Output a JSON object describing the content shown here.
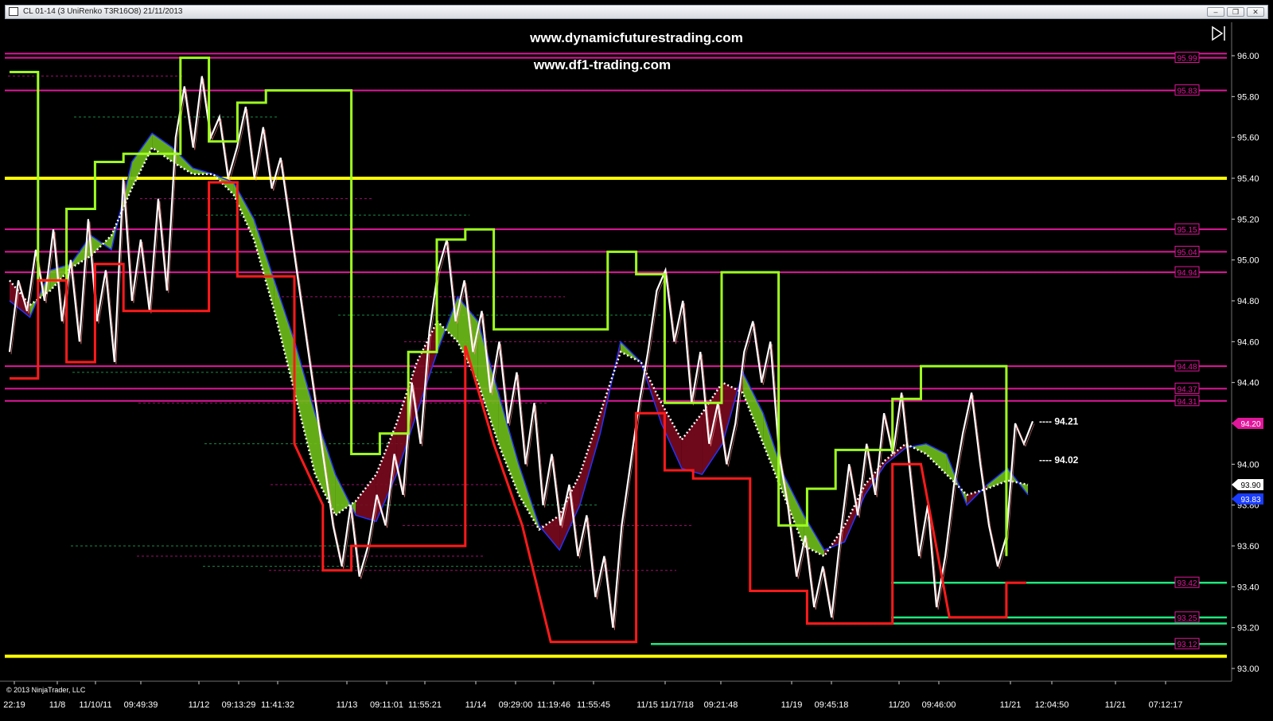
{
  "window": {
    "title": "CL 01-14 (3 UniRenko T3R16O8)  21/11/2013",
    "buttons": {
      "minimize": "–",
      "maximize": "❐",
      "close": "✕"
    }
  },
  "watermark": {
    "line1": "www.dynamicfuturestrading.com",
    "line2": "www.df1-trading.com"
  },
  "copyright": "© 2013 NinjaTrader, LLC",
  "colors": {
    "background": "#000000",
    "level_magenta": "#e0179a",
    "level_yellow": "#ffff00",
    "level_green": "#1fe87e",
    "channel_upper": "#9eff1f",
    "channel_lower": "#ff1a1a",
    "ribbon_bull": "#6fbf1a",
    "ribbon_bear": "#7a0a1e"
  },
  "chart_data": {
    "type": "line",
    "title": "",
    "ylim": [
      93.0,
      96.0
    ],
    "y_ticks": [
      "96.00",
      "95.80",
      "95.60",
      "95.40",
      "95.20",
      "95.00",
      "94.80",
      "94.60",
      "94.40",
      "94.20",
      "94.00",
      "93.80",
      "93.60",
      "93.40",
      "93.20",
      "93.00"
    ],
    "x_labels": [
      "22:19",
      "11/8",
      "11/10/11",
      "09:49:39",
      "11/12",
      "09:13:29",
      "11:41:32",
      "11/13",
      "09:11:01",
      "11:55:21",
      "11/14",
      "09:29:00",
      "11:19:46",
      "11:55:45",
      "11/15 11/17/18",
      "09:21:48",
      "11/19",
      "09:45:18",
      "11/20",
      "09:46:00",
      "11/21",
      "12:04:50",
      "11/21",
      "07:12:17"
    ],
    "level_labels": [
      {
        "value": 95.99,
        "label": "95.99",
        "color": "#e0179a"
      },
      {
        "value": 95.83,
        "label": "95.83",
        "color": "#e0179a"
      },
      {
        "value": 95.15,
        "label": "95.15",
        "color": "#e0179a"
      },
      {
        "value": 95.04,
        "label": "95.04",
        "color": "#e0179a"
      },
      {
        "value": 94.94,
        "label": "94.94",
        "color": "#e0179a"
      },
      {
        "value": 94.48,
        "label": "94.48",
        "color": "#e0179a"
      },
      {
        "value": 94.37,
        "label": "94.37",
        "color": "#e0179a"
      },
      {
        "value": 94.31,
        "label": "94.31",
        "color": "#e0179a"
      },
      {
        "value": 93.42,
        "label": "93.42",
        "color": "#e0179a"
      },
      {
        "value": 93.25,
        "label": "93.25",
        "color": "#e0179a"
      },
      {
        "value": 93.12,
        "label": "93.12",
        "color": "#e0179a"
      }
    ],
    "price_markers": [
      {
        "value": 94.2,
        "label": "94.20",
        "style": "magenta"
      },
      {
        "value": 93.9,
        "label": "93.90",
        "style": "white"
      },
      {
        "value": 93.83,
        "label": "93.83",
        "style": "blue"
      }
    ],
    "annotations": [
      {
        "value": 94.21,
        "label": "---- 94.21"
      },
      {
        "value": 94.02,
        "label": "---- 94.02"
      }
    ],
    "horizontal_levels": [
      {
        "value": 96.01,
        "color": "magenta"
      },
      {
        "value": 95.99,
        "color": "magenta"
      },
      {
        "value": 95.83,
        "color": "magenta"
      },
      {
        "value": 95.4,
        "color": "yellow"
      },
      {
        "value": 95.15,
        "color": "magenta"
      },
      {
        "value": 95.04,
        "color": "magenta"
      },
      {
        "value": 94.94,
        "color": "magenta"
      },
      {
        "value": 94.48,
        "color": "magenta"
      },
      {
        "value": 94.37,
        "color": "magenta"
      },
      {
        "value": 94.31,
        "color": "magenta"
      },
      {
        "value": 93.42,
        "color": "green"
      },
      {
        "value": 93.25,
        "color": "green"
      },
      {
        "value": 93.22,
        "color": "green"
      },
      {
        "value": 93.12,
        "color": "green"
      },
      {
        "value": 93.06,
        "color": "yellow"
      }
    ],
    "price_path": [
      94.55,
      94.9,
      94.75,
      95.05,
      94.8,
      95.15,
      94.7,
      95.0,
      94.6,
      95.2,
      94.7,
      94.95,
      94.5,
      95.4,
      94.8,
      95.1,
      94.75,
      95.3,
      94.85,
      95.6,
      95.85,
      95.55,
      95.9,
      95.6,
      95.7,
      95.4,
      95.55,
      95.75,
      95.4,
      95.65,
      95.35,
      95.5,
      95.2,
      94.9,
      94.6,
      94.3,
      94.0,
      93.7,
      93.5,
      93.8,
      93.45,
      93.6,
      93.85,
      93.7,
      94.05,
      93.85,
      94.4,
      94.1,
      94.65,
      94.95,
      95.1,
      94.7,
      94.9,
      94.55,
      94.75,
      94.35,
      94.6,
      94.2,
      94.45,
      94.0,
      94.3,
      93.8,
      94.05,
      93.7,
      93.9,
      93.55,
      93.75,
      93.35,
      93.55,
      93.2,
      93.7,
      94.0,
      94.3,
      94.55,
      94.85,
      94.95,
      94.6,
      94.8,
      94.3,
      94.55,
      94.1,
      94.3,
      94.0,
      94.2,
      94.55,
      94.7,
      94.4,
      94.6,
      94.05,
      93.8,
      93.45,
      93.65,
      93.3,
      93.5,
      93.25,
      93.65,
      94.0,
      93.75,
      94.1,
      93.85,
      94.25,
      94.05,
      94.35,
      93.95,
      93.55,
      93.8,
      93.3,
      93.55,
      93.9,
      94.15,
      94.35,
      94.0,
      93.7,
      93.5,
      93.65,
      94.2,
      94.1,
      94.21
    ],
    "upper_channel": [
      [
        0,
        95.92
      ],
      [
        1,
        95.92
      ],
      [
        1,
        94.9
      ],
      [
        2,
        94.9
      ],
      [
        2,
        95.25
      ],
      [
        3,
        95.25
      ],
      [
        3,
        95.48
      ],
      [
        4,
        95.48
      ],
      [
        4,
        95.52
      ],
      [
        6,
        95.52
      ],
      [
        6,
        95.99
      ],
      [
        7,
        95.99
      ],
      [
        7,
        95.58
      ],
      [
        8,
        95.58
      ],
      [
        8,
        95.77
      ],
      [
        9,
        95.77
      ],
      [
        9,
        95.83
      ],
      [
        12,
        95.83
      ],
      [
        12,
        94.05
      ],
      [
        13,
        94.05
      ],
      [
        13,
        94.15
      ],
      [
        14,
        94.15
      ],
      [
        14,
        94.55
      ],
      [
        15,
        94.55
      ],
      [
        15,
        95.1
      ],
      [
        16,
        95.1
      ],
      [
        16,
        95.15
      ],
      [
        17,
        95.15
      ],
      [
        17,
        94.66
      ],
      [
        21,
        94.66
      ],
      [
        21,
        95.04
      ],
      [
        22,
        95.04
      ],
      [
        22,
        94.93
      ],
      [
        23,
        94.93
      ],
      [
        23,
        94.3
      ],
      [
        25,
        94.3
      ],
      [
        25,
        94.94
      ],
      [
        27,
        94.94
      ],
      [
        27,
        93.7
      ],
      [
        28,
        93.7
      ],
      [
        28,
        93.88
      ],
      [
        29,
        93.88
      ],
      [
        29,
        94.07
      ],
      [
        31,
        94.07
      ],
      [
        31,
        94.32
      ],
      [
        32,
        94.32
      ],
      [
        32,
        94.48
      ],
      [
        35,
        94.48
      ],
      [
        35,
        93.55
      ]
    ],
    "lower_channel": [
      [
        0,
        94.42
      ],
      [
        1,
        94.42
      ],
      [
        1,
        94.9
      ],
      [
        2,
        94.9
      ],
      [
        2,
        94.5
      ],
      [
        3,
        94.5
      ],
      [
        3,
        94.98
      ],
      [
        4,
        94.98
      ],
      [
        4,
        94.75
      ],
      [
        7,
        94.75
      ],
      [
        7,
        95.38
      ],
      [
        8,
        95.38
      ],
      [
        8,
        94.92
      ],
      [
        10,
        94.92
      ],
      [
        10,
        94.1
      ],
      [
        11,
        93.8
      ],
      [
        11,
        93.48
      ],
      [
        12,
        93.48
      ],
      [
        12,
        93.6
      ],
      [
        16,
        93.6
      ],
      [
        16,
        94.58
      ],
      [
        17,
        94.1
      ],
      [
        18,
        93.7
      ],
      [
        19,
        93.13
      ],
      [
        22,
        93.13
      ],
      [
        22,
        94.25
      ],
      [
        23,
        94.25
      ],
      [
        23,
        93.97
      ],
      [
        24,
        93.97
      ],
      [
        24,
        93.93
      ],
      [
        26,
        93.93
      ],
      [
        26,
        93.38
      ],
      [
        28,
        93.38
      ],
      [
        28,
        93.22
      ],
      [
        31,
        93.22
      ],
      [
        31,
        94.0
      ],
      [
        32,
        94.0
      ],
      [
        33,
        93.25
      ],
      [
        35,
        93.25
      ],
      [
        35,
        93.42
      ],
      [
        35.7,
        93.42
      ]
    ],
    "ribbon_fast": [
      94.8,
      94.72,
      94.95,
      94.98,
      95.12,
      95.05,
      95.48,
      95.62,
      95.55,
      95.45,
      95.42,
      95.38,
      95.2,
      94.9,
      94.6,
      94.25,
      93.95,
      93.75,
      93.72,
      93.95,
      94.25,
      94.55,
      94.82,
      94.7,
      94.35,
      94.0,
      93.7,
      93.58,
      93.8,
      94.15,
      94.6,
      94.5,
      94.2,
      93.98,
      93.95,
      94.1,
      94.45,
      94.25,
      93.95,
      93.75,
      93.58,
      93.62,
      93.85,
      94.0,
      94.08,
      94.1,
      94.05,
      93.8,
      93.9,
      93.98,
      93.85
    ],
    "ribbon_slow": [
      94.9,
      94.78,
      94.85,
      94.96,
      95.02,
      95.12,
      95.35,
      95.55,
      95.48,
      95.42,
      95.42,
      95.32,
      95.1,
      94.75,
      94.35,
      93.95,
      93.75,
      93.82,
      93.95,
      94.2,
      94.5,
      94.7,
      94.6,
      94.4,
      94.1,
      93.85,
      93.68,
      93.75,
      93.95,
      94.25,
      94.55,
      94.5,
      94.3,
      94.12,
      94.25,
      94.4,
      94.35,
      94.1,
      93.85,
      93.6,
      93.55,
      93.7,
      93.9,
      94.02,
      94.1,
      94.05,
      93.95,
      93.85,
      93.88,
      93.92,
      93.9
    ]
  }
}
